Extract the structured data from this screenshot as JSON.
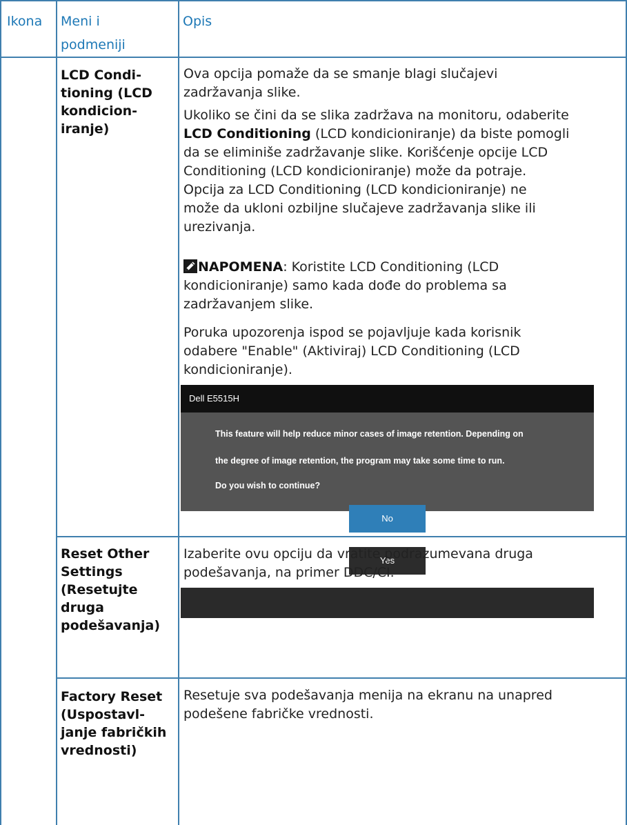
{
  "table": {
    "headers": {
      "icon": "Ikona",
      "menu_line1": "Meni i",
      "menu_line2": "podmeniji",
      "description": "Opis"
    },
    "rows": [
      {
        "menu_lines": [
          "LCD Condi-",
          "tioning (LCD",
          "kondicion-",
          "iranje)"
        ],
        "paragraphs": {
          "p1_lines": [
            "Ova opcija pomaže da se smanje blagi slučajevi",
            "zadržavanja slike."
          ],
          "p2_line1": "Ukoliko se čini da se slika zadržava na monitoru, odaberite",
          "p2_bold": "LCD Conditioning",
          "p2_line2_rest": " (LCD kondicioniranje) da biste pomogli",
          "p2_lines_more": [
            "da se eliminiše zadržavanje slike. Korišćenje opcije LCD",
            "Conditioning (LCD kondicioniranje) može da potraje.",
            "Opcija za LCD Conditioning (LCD kondicioniranje) ne",
            "može da ukloni ozbiljne slučajeve zadržavanja slike ili",
            "urezivanja."
          ],
          "note_label": "NAPOMENA",
          "note_line1_rest": ": Koristite LCD Conditioning (LCD",
          "note_lines_more": [
            "kondicioniranje) samo kada dođe do problema sa",
            "zadržavanjem slike."
          ],
          "p4_lines": [
            "Poruka upozorenja ispod se pojavljuje kada korisnik",
            "odabere \"Enable\" (Aktiviraj) LCD Conditioning (LCD",
            "kondicioniranje)."
          ]
        },
        "osd": {
          "title": "Dell E5515H",
          "message_lines": [
            "This feature will help reduce minor cases of image retention. Depending on",
            "the degree of image retention, the program may take some time to run.",
            "Do you wish to continue?"
          ],
          "btn_no": "No",
          "btn_yes": "Yes"
        }
      },
      {
        "menu_lines": [
          "Reset Other",
          "Settings",
          "(Resetujte",
          "druga",
          "podešavanja)"
        ],
        "desc_lines": [
          "Izaberite ovu opciju da vratite podrazumevana druga",
          "podešavanja, na primer DDC/CI."
        ]
      },
      {
        "menu_lines": [
          "Factory Reset",
          "(Uspostavl-",
          "janje fabričkih",
          "vrednosti)"
        ],
        "desc_lines": [
          "Resetuje sva podešavanja menija na ekranu na unapred",
          "podešene fabričke vrednosti."
        ]
      }
    ]
  },
  "colors": {
    "header_text": "#1d78b6",
    "grid_line": "#3f7fae",
    "osd_no_button": "#2f7fb8"
  },
  "icons": {
    "note": "pencil-note-icon"
  }
}
